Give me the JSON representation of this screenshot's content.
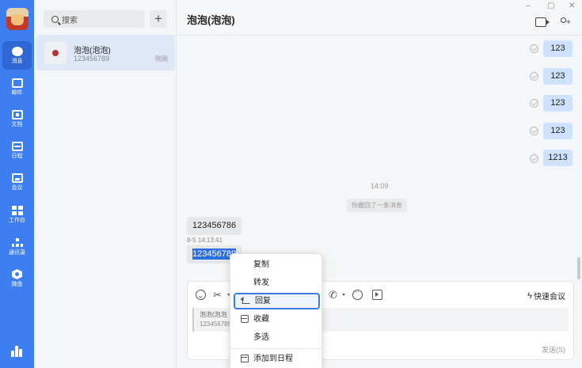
{
  "nav": {
    "items": [
      {
        "label": "消息",
        "icon": "message-icon",
        "active": true
      },
      {
        "label": "邮件",
        "icon": "mail-icon"
      },
      {
        "label": "文档",
        "icon": "document-icon"
      },
      {
        "label": "日程",
        "icon": "calendar-icon"
      },
      {
        "label": "会议",
        "icon": "meeting-icon"
      },
      {
        "label": "工作台",
        "icon": "workbench-icon"
      },
      {
        "label": "通讯录",
        "icon": "contacts-icon"
      },
      {
        "label": "微盘",
        "icon": "drive-icon"
      }
    ]
  },
  "search": {
    "placeholder": "搜索"
  },
  "conversations": [
    {
      "name": "泡泡(泡泡)",
      "preview": "123456789",
      "time": "刚刚"
    }
  ],
  "chat": {
    "title": "泡泡(泡泡)",
    "window_controls": {
      "minimize": "–",
      "maximize": "▢",
      "close": "✕"
    },
    "outgoing": [
      "123",
      "123",
      "123",
      "123",
      "1213"
    ],
    "time_separator": "14:09",
    "recall_notice": "你撤回了一条消息",
    "incoming": [
      "123456786",
      "123456789"
    ],
    "incoming_meta": "8-5 14:13:41"
  },
  "composer": {
    "quick_meeting": "快速会议",
    "quote_line1": "泡泡(泡泡",
    "quote_line2": "123456789",
    "send": "发送(S)"
  },
  "context_menu": {
    "items": [
      "复制",
      "转发",
      "回复",
      "收藏",
      "多选",
      "添加到日程"
    ],
    "active": "回复"
  },
  "colors": {
    "accent": "#3d7ef0",
    "bubble_out": "#cfe2fd",
    "selection": "#2e6fe0"
  }
}
